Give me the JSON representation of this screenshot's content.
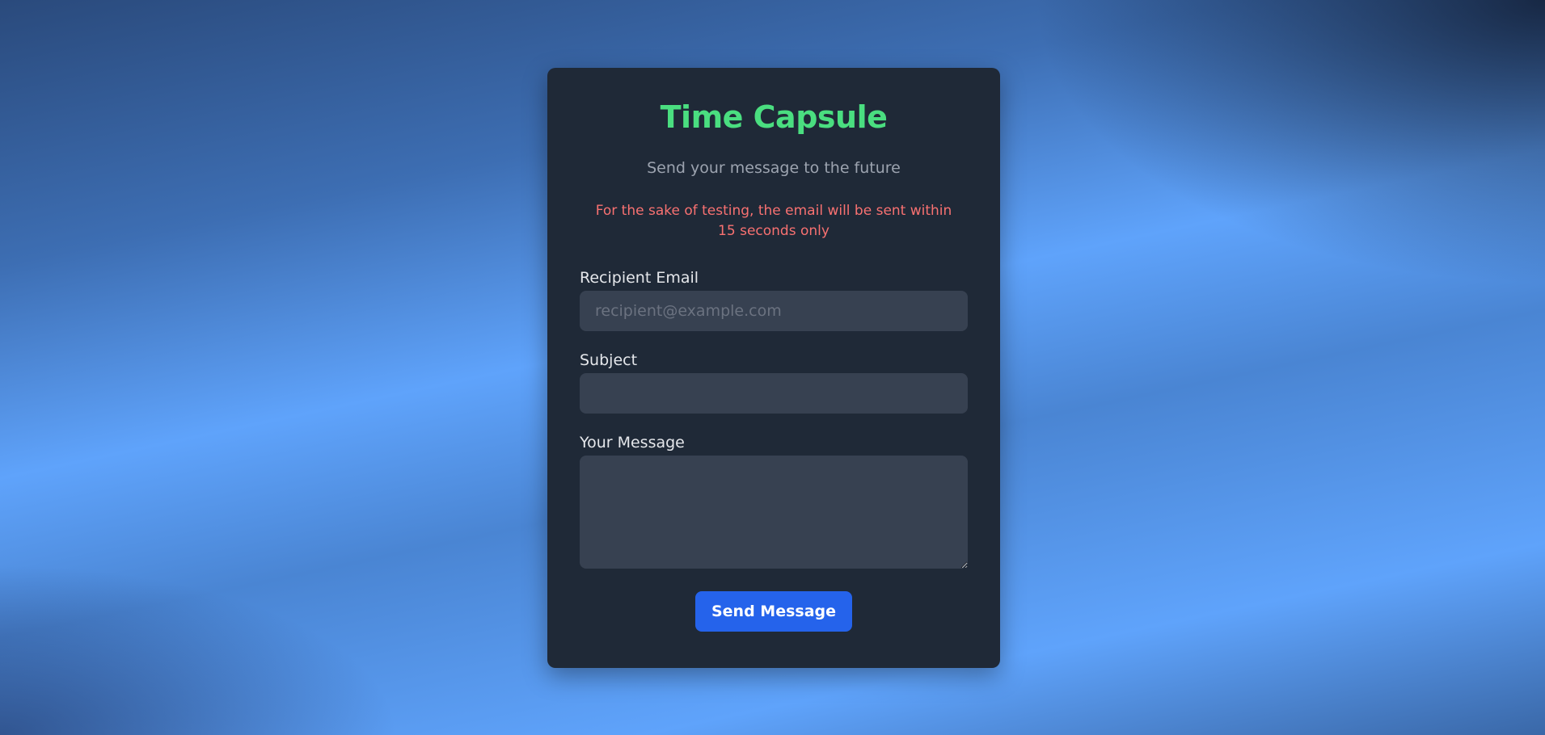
{
  "app": {
    "title": "Time Capsule",
    "subtitle": "Send your message to the future",
    "notice": "For the sake of testing, the email will be sent within 15 seconds only"
  },
  "form": {
    "recipient": {
      "label": "Recipient Email",
      "placeholder": "recipient@example.com",
      "value": ""
    },
    "subject": {
      "label": "Subject",
      "placeholder": "",
      "value": ""
    },
    "message": {
      "label": "Your Message",
      "placeholder": "",
      "value": ""
    },
    "submit_label": "Send Message"
  },
  "colors": {
    "title": "#4ade80",
    "notice": "#f87171",
    "card": "#1f2937",
    "input": "#374151",
    "button": "#2563eb"
  }
}
